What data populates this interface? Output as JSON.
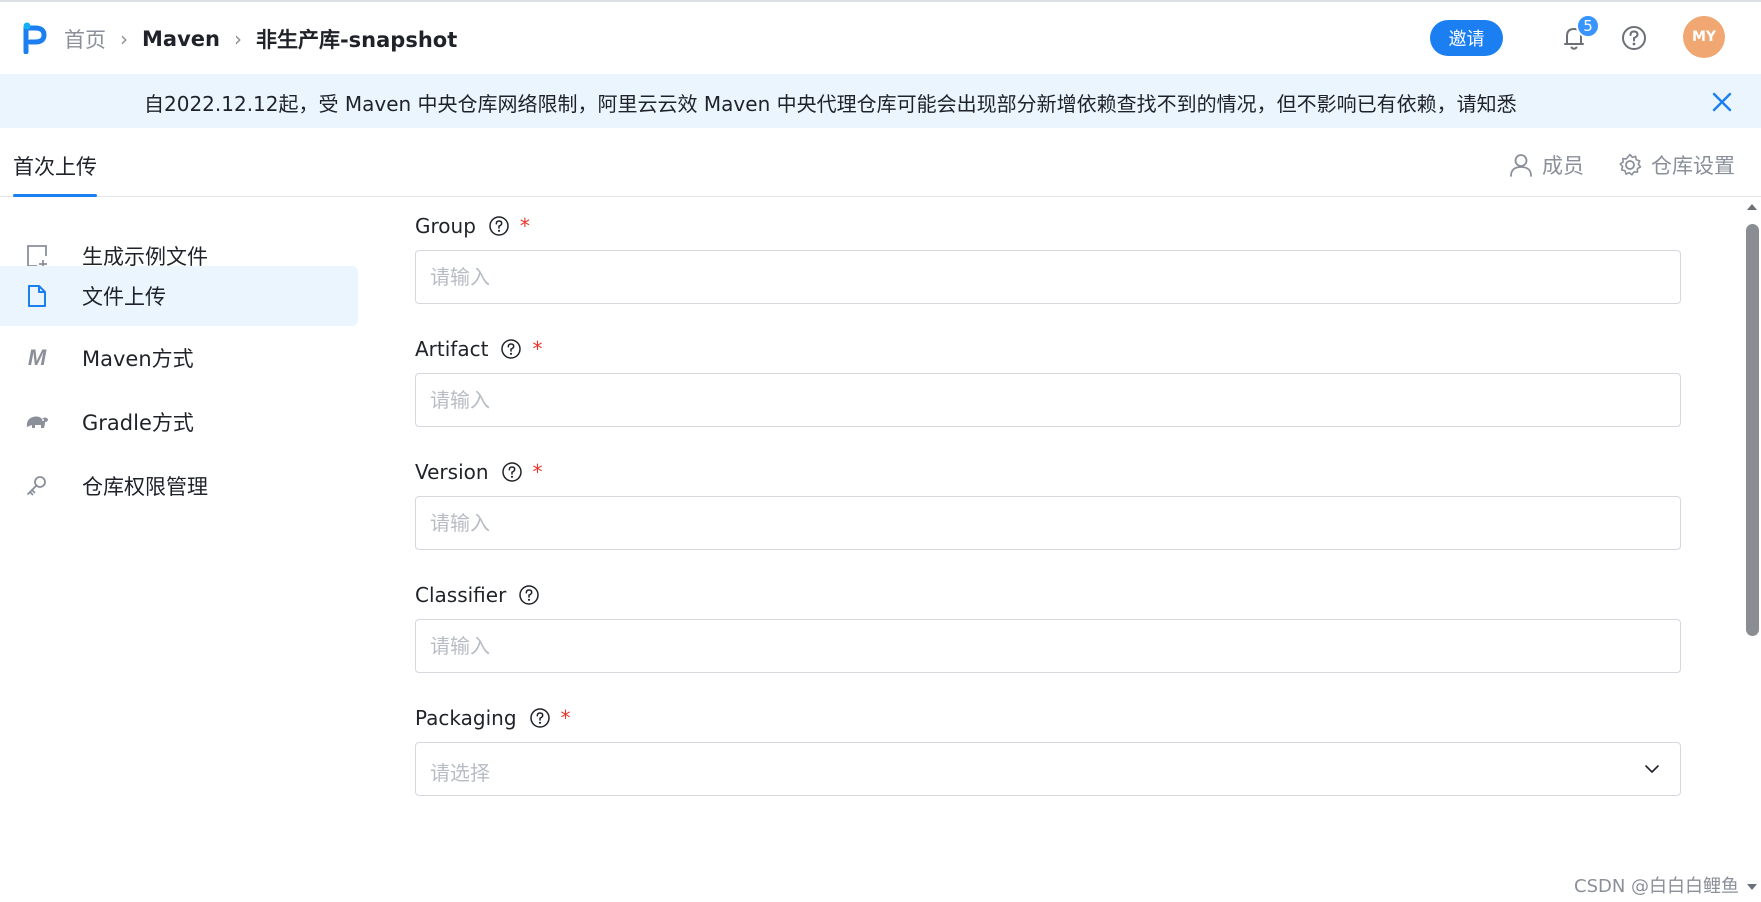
{
  "header": {
    "breadcrumb": {
      "home": "首页",
      "repo_group": "Maven",
      "current": "非生产库-snapshot"
    },
    "invite_label": "邀请",
    "notification_count": "5",
    "avatar_initials": "MY"
  },
  "banner": {
    "text": "自2022.12.12起，受 Maven 中央仓库网络限制，阿里云云效 Maven 中央代理仓库可能会出现部分新增依赖查找不到的情况，但不影响已有依赖，请知悉"
  },
  "tabs": {
    "active": "首次上传",
    "members": "成员",
    "settings": "仓库设置"
  },
  "sidebar": {
    "items": [
      {
        "label": "生成示例文件",
        "icon": "add-file-icon",
        "active": false
      },
      {
        "label": "文件上传",
        "icon": "file-icon",
        "active": true
      },
      {
        "label": "Maven方式",
        "icon": "maven-m-icon",
        "active": false
      },
      {
        "label": "Gradle方式",
        "icon": "gradle-elephant-icon",
        "active": false
      },
      {
        "label": "仓库权限管理",
        "icon": "key-icon",
        "active": false
      }
    ]
  },
  "form": {
    "group": {
      "label": "Group",
      "required": true,
      "placeholder": "请输入",
      "value": ""
    },
    "artifact": {
      "label": "Artifact",
      "required": true,
      "placeholder": "请输入",
      "value": ""
    },
    "version": {
      "label": "Version",
      "required": true,
      "placeholder": "请输入",
      "value": ""
    },
    "classifier": {
      "label": "Classifier",
      "required": false,
      "placeholder": "请输入",
      "value": ""
    },
    "packaging": {
      "label": "Packaging",
      "required": true,
      "placeholder": "请选择",
      "value": ""
    },
    "required_mark": "*"
  },
  "watermark": "CSDN @白白白鲤鱼",
  "colors": {
    "accent": "#1b7ff2",
    "banner_bg": "#eaf5fd",
    "avatar_bg": "#f0a772",
    "required": "#e8352b"
  }
}
